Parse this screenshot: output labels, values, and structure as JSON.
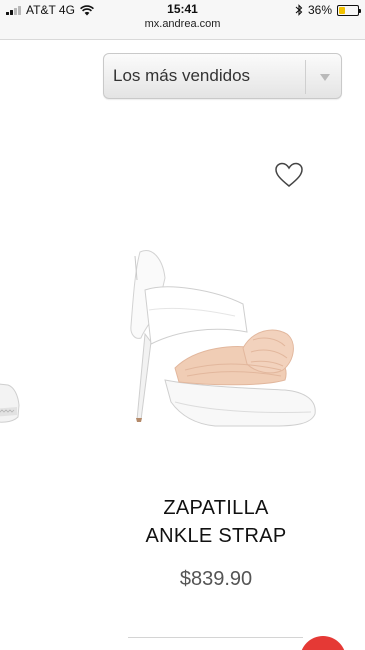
{
  "status_bar": {
    "carrier": "AT&T 4G",
    "time": "15:41",
    "battery": "36%",
    "battery_level": 0.36,
    "battery_color": "#f2c200"
  },
  "browser": {
    "url": "mx.andrea.com"
  },
  "sort": {
    "selected": "Los más vendidos"
  },
  "product": {
    "name_line1": "ZAPATILLA",
    "name_line2": "ANKLE STRAP",
    "price": "$839.90"
  },
  "icons": {
    "wishlist": "heart-icon",
    "dropdown": "chevron-down-icon",
    "bluetooth": "bluetooth-icon",
    "wifi": "wifi-icon"
  },
  "colors": {
    "accent_fab": "#e53935",
    "price": "#555555"
  }
}
